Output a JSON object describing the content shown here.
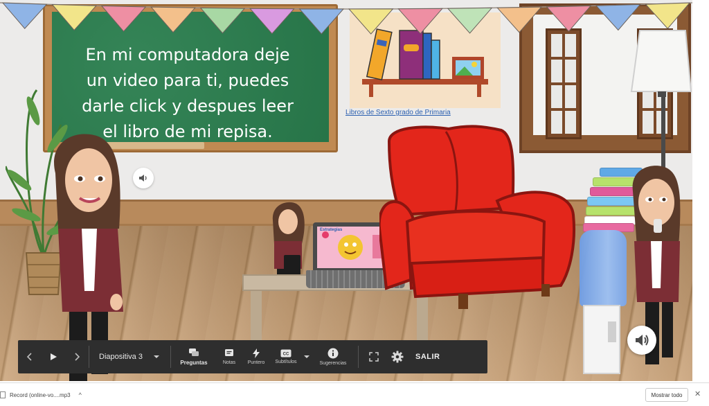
{
  "scene": {
    "chalkboard_text": "En mi computadora deje\nun video para ti, puedes\ndarle click y despues leer\nel libro de mi repisa.",
    "shelf_link": "Libros de Sexto grado de Primaria",
    "laptop_screen_caption": "Estrategias",
    "bunting_colors": [
      "#8fb4e6",
      "#f2e58a",
      "#ee8fa3",
      "#f3c08b",
      "#a8d8a4",
      "#d99ae0",
      "#8fb4e6",
      "#f2e58a",
      "#ee8fa3",
      "#bfe3b8",
      "#f3c08b",
      "#ee8fa3",
      "#8fb4e6",
      "#f2e58a"
    ],
    "armchair_color": "#e3261b",
    "board_color": "#2a7e4e"
  },
  "player": {
    "prev_icon": "chevron-left-icon",
    "play_icon": "play-icon",
    "next_icon": "chevron-right-icon",
    "slide_label": "Diapositiva 3",
    "questions_label": "Preguntas",
    "notes_label": "Notas",
    "pointer_label": "Puntero",
    "subtitles_label": "Subtítulos",
    "suggestions_label": "Sugerencias",
    "exit_label": "SALIR"
  },
  "downloads": {
    "file_name": "Record (online-vo....mp3",
    "show_all_label": "Mostrar todo"
  }
}
